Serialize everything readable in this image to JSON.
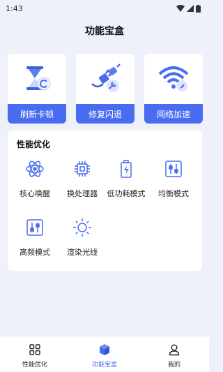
{
  "status_bar": {
    "time": "1:43"
  },
  "page_title": "功能宝盒",
  "tools": [
    {
      "label": "刷新卡顿",
      "icon": "hourglass-refresh-icon"
    },
    {
      "label": "修复闪退",
      "icon": "plug-wrench-icon"
    },
    {
      "label": "网络加速",
      "icon": "wifi-rocket-icon"
    }
  ],
  "performance": {
    "title": "性能优化",
    "items": [
      {
        "label": "核心唤醒",
        "icon": "atom-icon"
      },
      {
        "label": "换处理器",
        "icon": "cpu-chip-icon"
      },
      {
        "label": "低功耗模式",
        "icon": "battery-bolt-icon"
      },
      {
        "label": "均衡模式",
        "icon": "sliders-icon"
      },
      {
        "label": "高频模式",
        "icon": "sliders-icon"
      },
      {
        "label": "渲染光线",
        "icon": "sun-icon"
      }
    ]
  },
  "tabs": [
    {
      "label": "性能优化",
      "icon": "grid-icon",
      "active": false
    },
    {
      "label": "功能宝盒",
      "icon": "cube-icon",
      "active": true
    },
    {
      "label": "我的",
      "icon": "person-icon",
      "active": false
    }
  ],
  "colors": {
    "accent": "#4a6cf0",
    "background": "#eef1fa"
  }
}
